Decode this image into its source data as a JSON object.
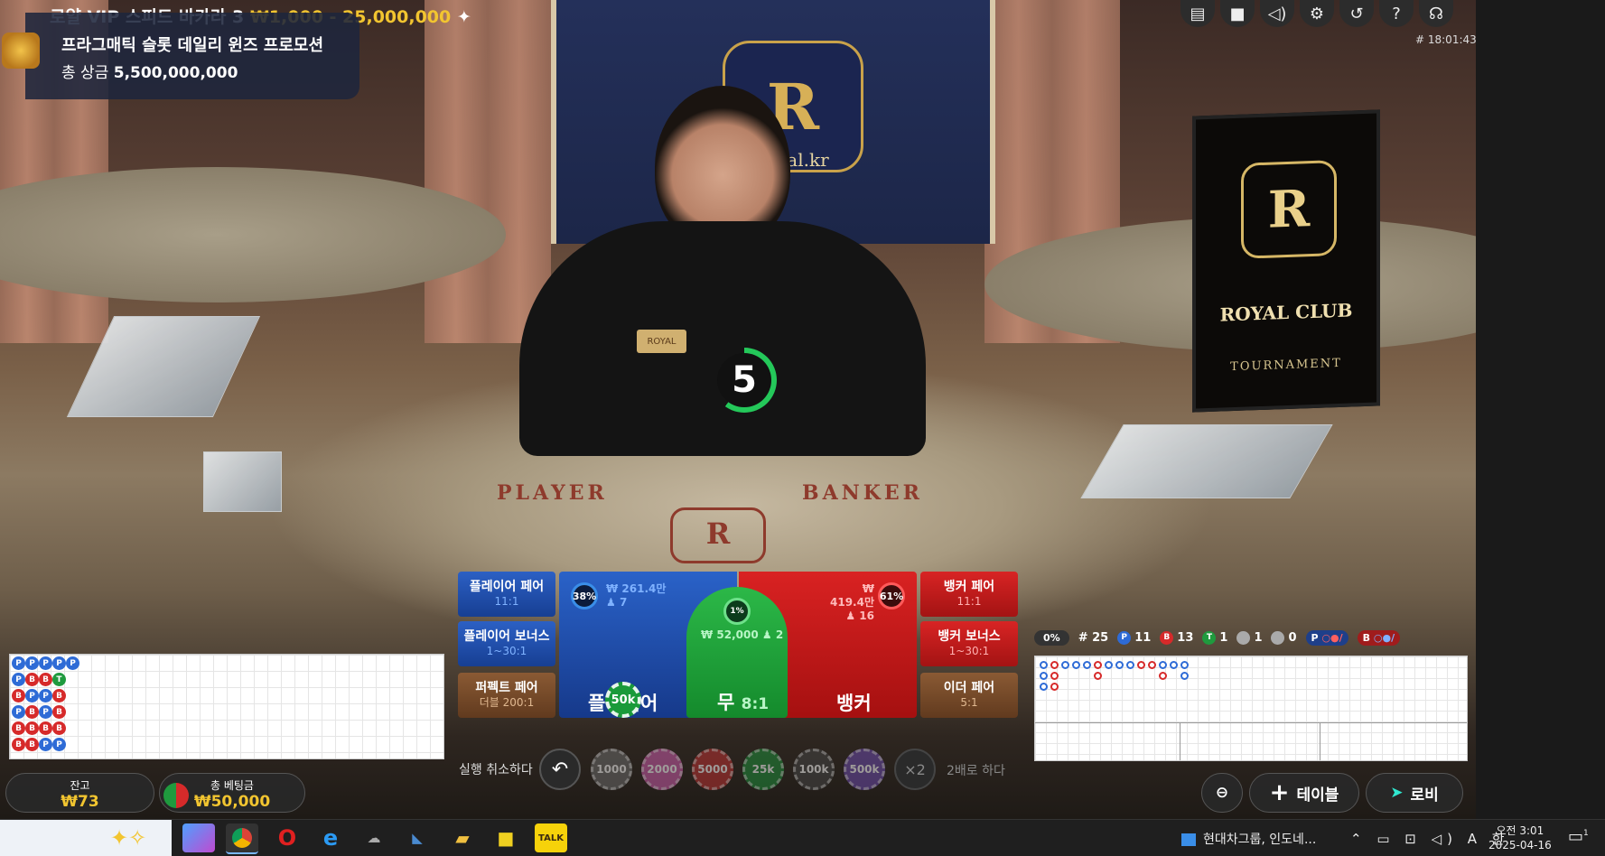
{
  "header": {
    "title": "로얄 VIP 스피드 바카라 3",
    "limits": "₩1,000 - 25,000,000",
    "game_id": "# 18:01:43"
  },
  "promo": {
    "line1": "프라그매틱 슬롯 데일리 윈즈 프로모션",
    "line2_prefix": "총 상금",
    "line2_amount": "5,500,000,000"
  },
  "top_icons": [
    "chat-icon",
    "video-icon",
    "volume-icon",
    "gear-icon",
    "history-icon",
    "help-icon",
    "support-icon"
  ],
  "scene": {
    "felt_player": "PLAYER",
    "felt_banker": "BANKER",
    "board_club": "ROYAL CLUB",
    "board_tournament": "TOURNAMENT",
    "crest_text": "yal.kr",
    "badge": "ROYAL"
  },
  "timer": {
    "value": "5",
    "remaining_fraction": 0.6,
    "color": "#24c85a"
  },
  "bets": {
    "player_pair": {
      "label": "플레이어 페어",
      "odds": "11:1"
    },
    "player_bonus": {
      "label": "플레이어 보너스",
      "odds": "1~30:1"
    },
    "perfect_pair": {
      "label": "퍼펙트 페어",
      "odds": "더블 200:1"
    },
    "banker_pair": {
      "label": "뱅커 페어",
      "odds": "11:1"
    },
    "banker_bonus": {
      "label": "뱅커 보너스",
      "odds": "1~30:1"
    },
    "either_pair": {
      "label": "이더 페어",
      "odds": "5:1"
    },
    "player": {
      "label": "플레이어",
      "pct": "38%",
      "amount": "₩ 261.4만",
      "players": "7",
      "chip": "50k"
    },
    "tie": {
      "label": "무",
      "odds": "8:1",
      "pct": "1%",
      "amount": "₩ 52,000",
      "players": "2"
    },
    "banker": {
      "label": "뱅커",
      "pct": "61%",
      "amount": "₩ 419.4만",
      "players": "16"
    }
  },
  "road_stats": {
    "percent": "0%",
    "rounds": "# 25",
    "player": "11",
    "banker": "13",
    "tie": "1",
    "player_pair": "1",
    "banker_pair": "0",
    "pred_p": "P",
    "pred_b": "B"
  },
  "bead_road": [
    [
      "P",
      "P",
      "B",
      "P",
      "B",
      "B"
    ],
    [
      "P",
      "B",
      "P",
      "B",
      "B",
      "B"
    ],
    [
      "P",
      "B",
      "P",
      "P",
      "B",
      "P"
    ],
    [
      "P",
      "T",
      "B",
      "B",
      "B",
      "P"
    ],
    [
      "P"
    ]
  ],
  "chips": {
    "undo_label": "실행 취소하다",
    "values": [
      "1000",
      "2000",
      "5000",
      "25k",
      "100k",
      "500k"
    ],
    "colors": [
      "#6a6a6a",
      "#c85ca8",
      "#b83232",
      "#1f8a3a",
      "#444444",
      "#6a4aa8"
    ],
    "double_symbol": "×2",
    "double_label": "2배로 하다"
  },
  "balance": {
    "label": "잔고",
    "value": "₩73"
  },
  "total_bet": {
    "label": "총 베팅금",
    "value": "₩50,000"
  },
  "bottom_buttons": {
    "table": "테이블",
    "lobby": "로비"
  },
  "taskbar": {
    "news": "현대차그룹, 인도네...",
    "tray": "⌃ ▭ ⊡ ◁) A 한",
    "time": "오전 3:01",
    "date": "2025-04-16",
    "notifications": "1"
  }
}
